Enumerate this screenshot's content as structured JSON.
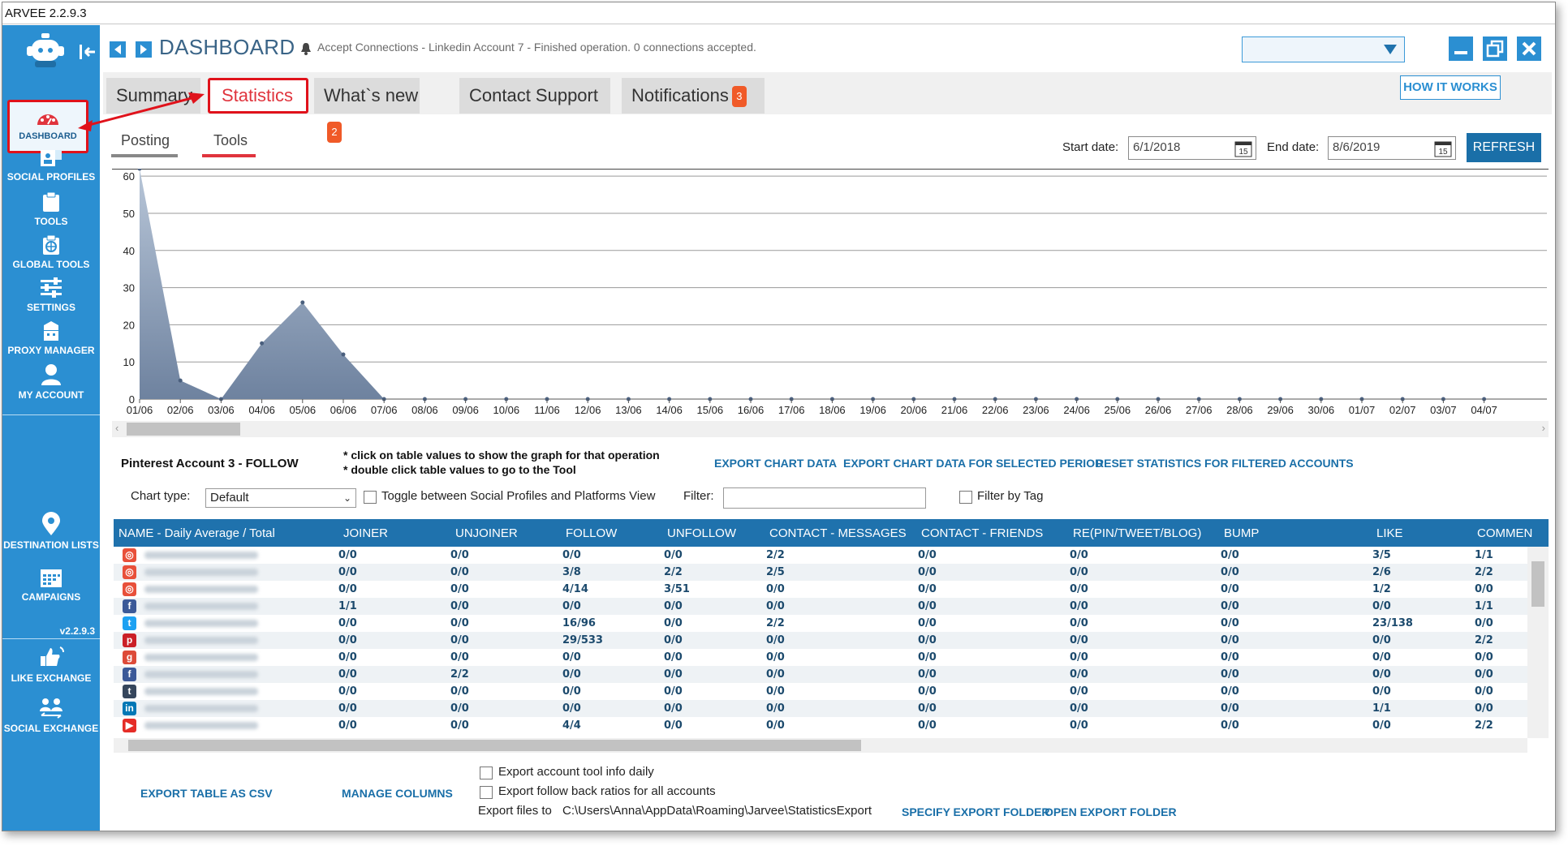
{
  "app": {
    "title": "ARVEE 2.2.9.3"
  },
  "sidebar": {
    "version": "v2.2.9.3",
    "items": [
      {
        "label": "DASHBOARD",
        "icon": "dashboard-icon"
      },
      {
        "label": "SOCIAL PROFILES",
        "icon": "social-profiles-icon"
      },
      {
        "label": "TOOLS",
        "icon": "clipboard-icon"
      },
      {
        "label": "GLOBAL TOOLS",
        "icon": "globe-tools-icon"
      },
      {
        "label": "SETTINGS",
        "icon": "sliders-icon"
      },
      {
        "label": "PROXY MANAGER",
        "icon": "proxy-icon"
      },
      {
        "label": "MY ACCOUNT",
        "icon": "user-icon"
      },
      {
        "label": "DESTINATION LISTS",
        "icon": "map-pin-icon"
      },
      {
        "label": "CAMPAIGNS",
        "icon": "calendar-icon"
      },
      {
        "label": "LIKE EXCHANGE",
        "icon": "like-exchange-icon"
      },
      {
        "label": "SOCIAL EXCHANGE",
        "icon": "social-exchange-icon"
      }
    ]
  },
  "header": {
    "title": "DASHBOARD",
    "notification": "Accept Connections - Linkedin Account 7 - Finished operation. 0 connections accepted."
  },
  "tabs": [
    {
      "label": "Summary"
    },
    {
      "label": "Statistics"
    },
    {
      "label": "What`s new",
      "badge": "2"
    },
    {
      "label": "Contact Support"
    },
    {
      "label": "Notifications",
      "badge": "3"
    }
  ],
  "how_it_works": "HOW IT WORKS",
  "subtabs": [
    {
      "label": "Posting"
    },
    {
      "label": "Tools"
    }
  ],
  "dates": {
    "start_label": "Start date:",
    "start_value": "6/1/2018",
    "end_label": "End date:",
    "end_value": "8/6/2019",
    "calendar_day": "15"
  },
  "refresh": "REFRESH",
  "chart_data": {
    "type": "area",
    "ylim": [
      0,
      62
    ],
    "yticks": [
      "0",
      "10",
      "20",
      "30",
      "40",
      "50",
      "60"
    ],
    "categories": [
      "01/06",
      "02/06",
      "03/06",
      "04/06",
      "05/06",
      "06/06",
      "07/06",
      "08/06",
      "09/06",
      "10/06",
      "11/06",
      "12/06",
      "13/06",
      "14/06",
      "15/06",
      "16/06",
      "17/06",
      "18/06",
      "19/06",
      "20/06",
      "21/06",
      "22/06",
      "23/06",
      "24/06",
      "25/06",
      "26/06",
      "27/06",
      "28/06",
      "29/06",
      "30/06",
      "01/07",
      "02/07",
      "03/07",
      "04/07"
    ],
    "values": [
      62,
      5,
      0,
      15,
      26,
      12,
      0,
      0,
      0,
      0,
      0,
      0,
      0,
      0,
      0,
      0,
      0,
      0,
      0,
      0,
      0,
      0,
      0,
      0,
      0,
      0,
      0,
      0,
      0,
      0,
      0,
      0,
      0,
      0
    ],
    "fill_top": "#b8c6d8",
    "fill_bottom": "#6e829f"
  },
  "info": {
    "account": "Pinterest Account 3 - FOLLOW",
    "note1": "* click on table values to show the graph for that operation",
    "note2": "* double click table values to go to the Tool",
    "export_chart": "EXPORT CHART DATA",
    "export_chart_period": "EXPORT CHART DATA FOR SELECTED PERIOD",
    "reset_stats": "RESET STATISTICS FOR FILTERED ACCOUNTS",
    "chart_type_label": "Chart type:",
    "chart_type_value": "Default",
    "toggle_label": "Toggle between Social Profiles and Platforms View",
    "filter_label": "Filter:",
    "filter_by_tag": "Filter by Tag"
  },
  "table": {
    "headers": [
      "NAME - Daily Average / Total",
      "JOINER",
      "UNJOINER",
      "FOLLOW",
      "UNFOLLOW",
      "CONTACT - MESSAGES",
      "CONTACT - FRIENDS",
      "RE(PIN/TWEET/BLOG)",
      "BUMP",
      "LIKE",
      "COMMEN"
    ],
    "rows": [
      {
        "platform": "instagram",
        "cells": [
          "0/0",
          "0/0",
          "0/0",
          "0/0",
          "2/2",
          "0/0",
          "0/0",
          "0/0",
          "3/5",
          "1/1"
        ]
      },
      {
        "platform": "instagram",
        "cells": [
          "0/0",
          "0/0",
          "3/8",
          "2/2",
          "2/5",
          "0/0",
          "0/0",
          "0/0",
          "2/6",
          "2/2"
        ]
      },
      {
        "platform": "instagram",
        "cells": [
          "0/0",
          "0/0",
          "4/14",
          "3/51",
          "0/0",
          "0/0",
          "0/0",
          "0/0",
          "1/2",
          "0/0"
        ]
      },
      {
        "platform": "facebook",
        "cells": [
          "1/1",
          "0/0",
          "0/0",
          "0/0",
          "0/0",
          "0/0",
          "0/0",
          "0/0",
          "0/0",
          "1/1"
        ]
      },
      {
        "platform": "twitter",
        "cells": [
          "0/0",
          "0/0",
          "16/96",
          "0/0",
          "2/2",
          "0/0",
          "0/0",
          "0/0",
          "23/138",
          "0/0"
        ]
      },
      {
        "platform": "pinterest",
        "cells": [
          "0/0",
          "0/0",
          "29/533",
          "0/0",
          "0/0",
          "0/0",
          "0/0",
          "0/0",
          "0/0",
          "2/2"
        ]
      },
      {
        "platform": "googleplus",
        "cells": [
          "0/0",
          "0/0",
          "0/0",
          "0/0",
          "0/0",
          "0/0",
          "0/0",
          "0/0",
          "0/0",
          "0/0"
        ]
      },
      {
        "platform": "facebook",
        "cells": [
          "0/0",
          "2/2",
          "0/0",
          "0/0",
          "0/0",
          "0/0",
          "0/0",
          "0/0",
          "0/0",
          "0/0"
        ]
      },
      {
        "platform": "tumblr",
        "cells": [
          "0/0",
          "0/0",
          "0/0",
          "0/0",
          "0/0",
          "0/0",
          "0/0",
          "0/0",
          "0/0",
          "0/0"
        ]
      },
      {
        "platform": "linkedin",
        "cells": [
          "0/0",
          "0/0",
          "0/0",
          "0/0",
          "0/0",
          "0/0",
          "0/0",
          "0/0",
          "1/1",
          "0/0"
        ]
      },
      {
        "platform": "youtube",
        "cells": [
          "0/0",
          "0/0",
          "4/4",
          "0/0",
          "0/0",
          "0/0",
          "0/0",
          "0/0",
          "0/0",
          "2/2"
        ]
      }
    ]
  },
  "footer": {
    "export_csv": "EXPORT TABLE AS CSV",
    "manage_columns": "MANAGE COLUMNS",
    "export_daily": "Export account tool info daily",
    "export_ratios": "Export follow back ratios for all accounts",
    "export_files_label": "Export files to",
    "export_path": "C:\\Users\\Anna\\AppData\\Roaming\\Jarvee\\StatisticsExport",
    "specify_folder": "SPECIFY EXPORT FOLDER",
    "open_folder": "OPEN EXPORT FOLDER"
  },
  "colors": {
    "sidebar": "#2b8fd2",
    "table_header": "#1f72ad",
    "link": "#1a6fa8",
    "highlight": "#e0121b",
    "badge": "#f05a28",
    "instagram": "#e8503a",
    "facebook": "#3b5998",
    "twitter": "#1da1f2",
    "pinterest": "#cb2027",
    "googleplus": "#dd4b39",
    "tumblr": "#35465c",
    "linkedin": "#0077b5",
    "youtube": "#e52d27"
  }
}
